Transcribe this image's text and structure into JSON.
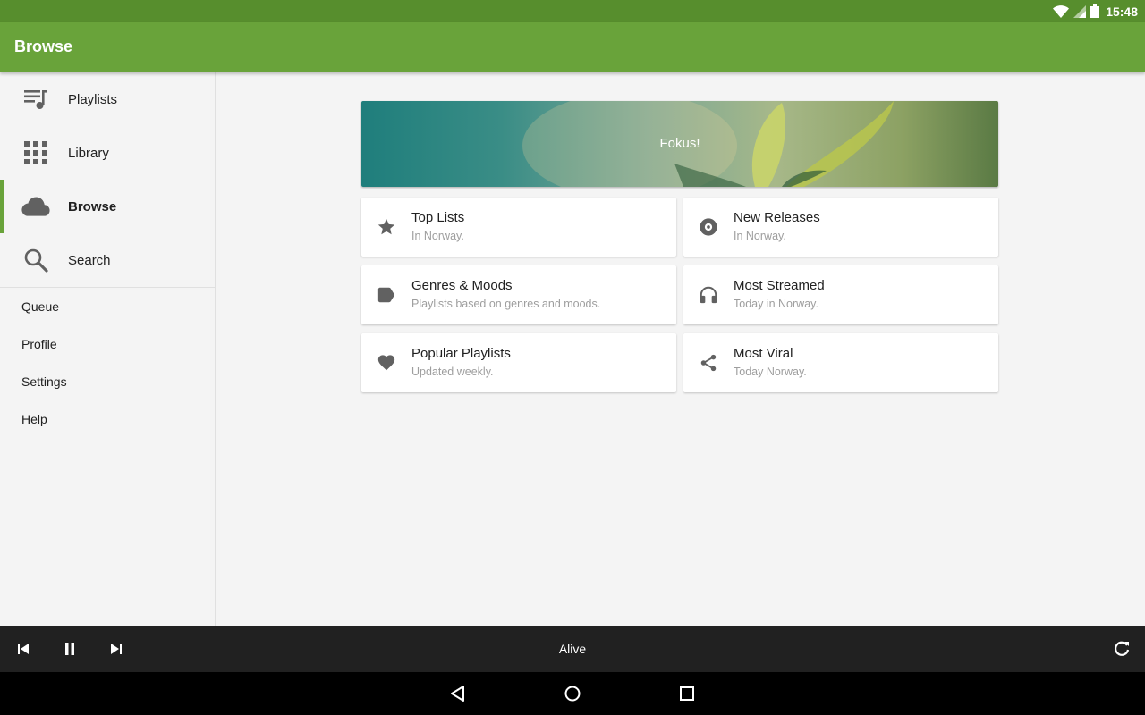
{
  "status_bar": {
    "time": "15:48",
    "icons": [
      "wifi-icon",
      "signal-icon",
      "battery-icon"
    ]
  },
  "app_bar": {
    "title": "Browse"
  },
  "sidebar": {
    "primary": [
      {
        "label": "Playlists",
        "icon": "playlist-icon",
        "active": false
      },
      {
        "label": "Library",
        "icon": "grid-icon",
        "active": false
      },
      {
        "label": "Browse",
        "icon": "cloud-icon",
        "active": true
      },
      {
        "label": "Search",
        "icon": "search-icon",
        "active": false
      }
    ],
    "secondary": [
      {
        "label": "Queue"
      },
      {
        "label": "Profile"
      },
      {
        "label": "Settings"
      },
      {
        "label": "Help"
      }
    ]
  },
  "banner": {
    "label": "Fokus!"
  },
  "cards": [
    {
      "title": "Top Lists",
      "subtitle": "In Norway.",
      "icon": "star-icon"
    },
    {
      "title": "New Releases",
      "subtitle": "In Norway.",
      "icon": "disc-icon"
    },
    {
      "title": "Genres & Moods",
      "subtitle": "Playlists based on genres and moods.",
      "icon": "tag-icon"
    },
    {
      "title": "Most Streamed",
      "subtitle": "Today in Norway.",
      "icon": "headphones-icon"
    },
    {
      "title": "Popular Playlists",
      "subtitle": "Updated weekly.",
      "icon": "heart-icon"
    },
    {
      "title": "Most Viral",
      "subtitle": "Today Norway.",
      "icon": "share-icon"
    }
  ],
  "player": {
    "track": "Alive"
  },
  "colors": {
    "accent": "#69a33a",
    "status_bar": "#578e2d",
    "player_bg": "#212121"
  }
}
